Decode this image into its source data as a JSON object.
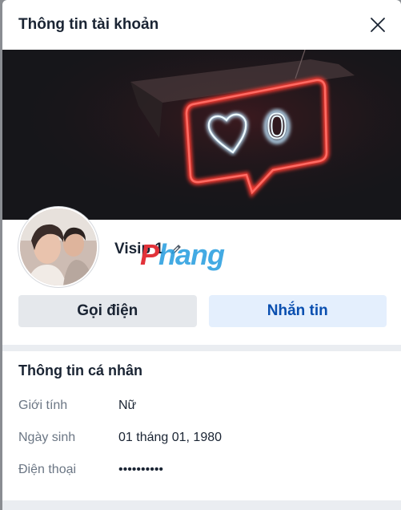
{
  "modal": {
    "title": "Thông tin tài khoản"
  },
  "cover": {
    "icon": "neon-heart-speech-bubble",
    "counter": "0",
    "colors": {
      "neon_red": "#ff3b30",
      "neon_white": "#e8f6ff"
    }
  },
  "profile": {
    "name": "Visip 1",
    "avatar_icon": "user-photo"
  },
  "watermark": {
    "first": "P",
    "rest": "hang"
  },
  "actions": {
    "call_label": "Gọi điện",
    "message_label": "Nhắn tin"
  },
  "personal_info": {
    "title": "Thông tin cá nhân",
    "rows": [
      {
        "label": "Giới tính",
        "value": "Nữ"
      },
      {
        "label": "Ngày sinh",
        "value": "01 tháng 01, 1980"
      },
      {
        "label": "Điện thoại",
        "value": "••••••••••"
      }
    ]
  },
  "colors": {
    "accent": "#0a4fb0",
    "accent_bg": "#e4effd",
    "secondary_bg": "#e5e8ec"
  }
}
